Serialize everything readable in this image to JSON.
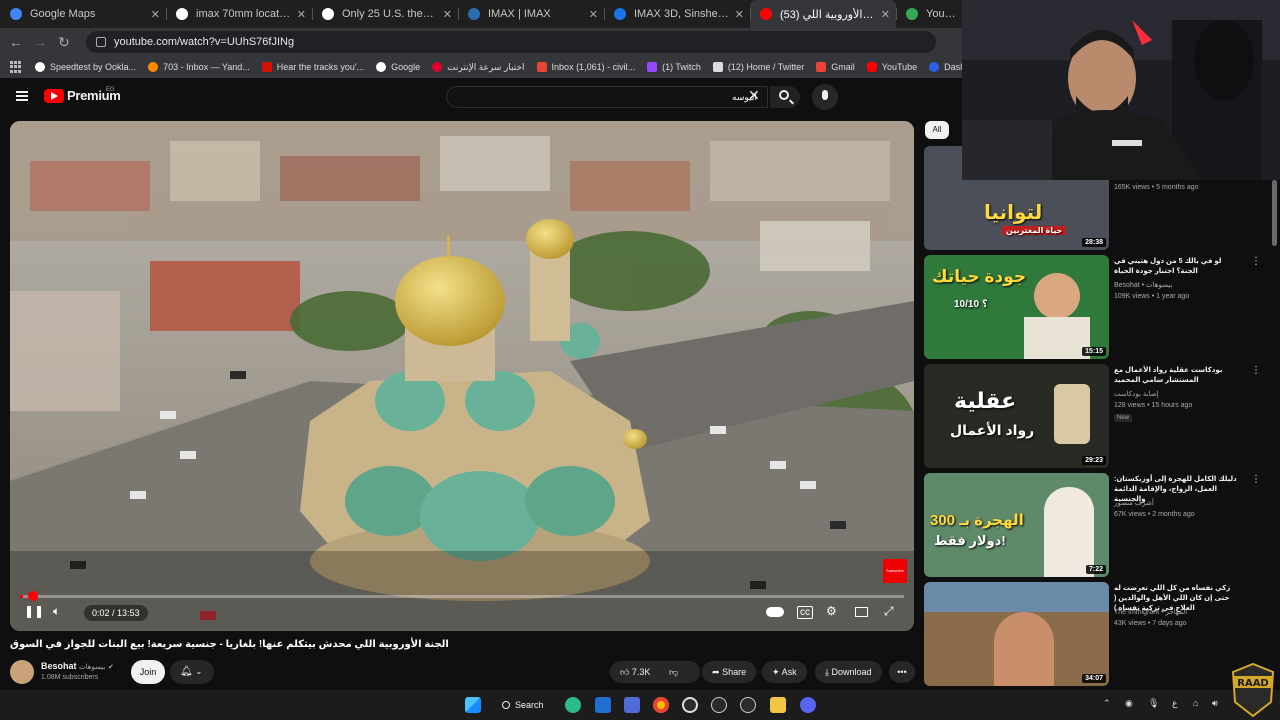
{
  "browser": {
    "tabs": [
      {
        "label": "Google Maps",
        "color": "#4285f4"
      },
      {
        "label": "imax 70mm locations - Goo",
        "color": "#ffffff"
      },
      {
        "label": "Only 25 U.S. theaters can sh",
        "color": "#ffffff"
      },
      {
        "label": "IMAX | IMAX",
        "color": "#2b6cb0"
      },
      {
        "label": "IMAX 3D, Sinsheim Auto &",
        "color": "#1a73e8"
      },
      {
        "label": "(53) الجنة الأوروبية اللي",
        "color": "#ff0000",
        "active": true
      },
      {
        "label": "Your locati",
        "color": "#34a853"
      }
    ],
    "url": "youtube.com/watch?v=UUhS76fJINg",
    "bookmarks": [
      {
        "label": "Speedtest by Ookla...",
        "color": "#ffffff"
      },
      {
        "label": "703 - Inbox — Yand...",
        "color": "#ff8a00"
      },
      {
        "label": "Hear the tracks you'...",
        "color": "#d51007"
      },
      {
        "label": "Google",
        "color": "#ffffff"
      },
      {
        "label": "اختبار سرعة الإنترنت",
        "color": "#e1002a"
      },
      {
        "label": "Inbox (1,061) - civil...",
        "color": "#ea4335"
      },
      {
        "label": "(1) Twitch",
        "color": "#9146ff"
      },
      {
        "label": "(12) Home / Twitter",
        "color": "#ffffff"
      },
      {
        "label": "Gmail",
        "color": "#ea4335"
      },
      {
        "label": "YouTube",
        "color": "#ff0000"
      },
      {
        "label": "Dashboard - Restre...",
        "color": "#2b5fe6"
      }
    ]
  },
  "youtube": {
    "logo_text": "Premium",
    "logo_sup": "EG",
    "search_query": "اليوسه",
    "player": {
      "progress": 0.003,
      "time": "0:02 / 13:53",
      "watermark": "Subscribe"
    },
    "video_title": "الجنة الأوروبية اللي محدش بيتكلم عنها! بلغاريا - جنسية سريعة! بيع البنات للجواز في السوق",
    "channel": {
      "name": "Besohat",
      "name_ar": "بيسوهات",
      "subscribers": "1.08M subscribers",
      "join": "Join"
    },
    "actions": {
      "likes": "7.3K",
      "share": "Share",
      "ask": "Ask",
      "download": "Download"
    },
    "filter_chip": "All",
    "recommendations": [
      {
        "title": "",
        "channel": "",
        "meta": "165K views • 5 months ago",
        "duration": "28:38",
        "thumb_text": "لتوانيا",
        "thumb_sub": "حياة المغتربين",
        "bg": "#4a4f58"
      },
      {
        "title": "لو في بالك 5 من دول هتيني في الجنة؟ اختبار جودة الحياة",
        "channel": "Besohat • بيسوهات",
        "meta": "109K views • 1 year ago",
        "duration": "15:15",
        "thumb_text": "جودة حياتك",
        "thumb_sub": "10/10 ؟",
        "bg": "#2f7a3b"
      },
      {
        "title": "بودكاست عقلية رواد الأعمال مع المستشار سامي المحميد",
        "channel": "إصابة بودكاست",
        "meta": "128 views • 15 hours ago",
        "badge": "New",
        "duration": "29:23",
        "thumb_text": "عقلية",
        "thumb_sub": "رواد الأعمال",
        "bg": "#2a2a24"
      },
      {
        "title": "دليلك الكامل للهجرة إلى أوزبكستان: العمل، الزواج، والإقامة الدائمة والجنسية",
        "channel": "أشرف منصور",
        "meta": "67K views • 2 months ago",
        "duration": "7:22",
        "thumb_text": "الهجرة بـ 300",
        "thumb_sub": "دولار فقط!",
        "bg": "#5f8a6a"
      },
      {
        "title": "زكي نفساه من كل اللي تعرضت له حتى إن كان اللي الأهل والوالدين ( العلاج في تزكية نفساه )",
        "channel": "The Immigrant • المهاجر",
        "meta": "43K views • 7 days ago",
        "duration": "34:07",
        "thumb_text": "",
        "thumb_sub": "",
        "bg": "#8a6b4a"
      }
    ]
  },
  "taskbar": {
    "search_label": "Search",
    "tray_lang": "ع"
  }
}
